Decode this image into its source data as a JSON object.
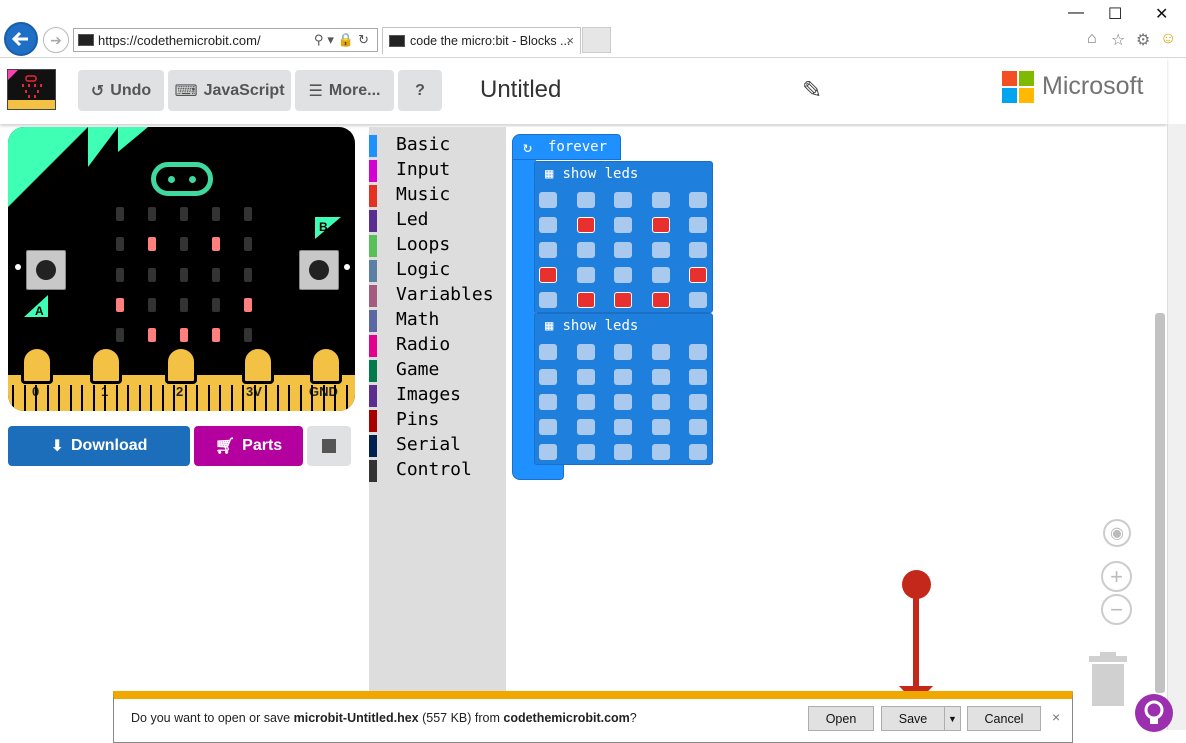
{
  "browser": {
    "url": "https://codethemicrobit.com/",
    "tab_title": "code the micro:bit - Blocks ...",
    "tab_close": "×",
    "window_controls": [
      "—",
      "☐",
      "✕"
    ]
  },
  "toolbar": {
    "undo_label": "Undo",
    "javascript_label": "JavaScript",
    "more_label": "More...",
    "help_label": "?",
    "project_title": "Untitled",
    "brand": "Microsoft"
  },
  "simulator": {
    "pins": [
      "0",
      "1",
      "2",
      "3V",
      "GND"
    ],
    "button_a": "A",
    "button_b": "B",
    "leds": [
      [
        0,
        0,
        0,
        0,
        0
      ],
      [
        0,
        1,
        0,
        1,
        0
      ],
      [
        0,
        0,
        0,
        0,
        0
      ],
      [
        1,
        0,
        0,
        0,
        1
      ],
      [
        0,
        1,
        1,
        1,
        0
      ]
    ],
    "download_label": "Download",
    "parts_label": "Parts"
  },
  "toolbox": {
    "categories": [
      {
        "label": "Basic",
        "color": "#1e90ff"
      },
      {
        "label": "Input",
        "color": "#d400d4"
      },
      {
        "label": "Music",
        "color": "#e63022"
      },
      {
        "label": "Led",
        "color": "#5c2d91"
      },
      {
        "label": "Loops",
        "color": "#59c059"
      },
      {
        "label": "Logic",
        "color": "#5b80a5"
      },
      {
        "label": "Variables",
        "color": "#a55b80"
      },
      {
        "label": "Math",
        "color": "#5b67a5"
      },
      {
        "label": "Radio",
        "color": "#e3008c"
      },
      {
        "label": "Game",
        "color": "#007a4b"
      },
      {
        "label": "Images",
        "color": "#5c2d91"
      },
      {
        "label": "Pins",
        "color": "#a80000"
      },
      {
        "label": "Serial",
        "color": "#002050"
      },
      {
        "label": "Control",
        "color": "#333333"
      }
    ]
  },
  "workspace": {
    "forever_label": "forever",
    "show_leds_label": "show leds",
    "blocks": [
      {
        "leds": [
          [
            0,
            0,
            0,
            0,
            0
          ],
          [
            0,
            1,
            0,
            1,
            0
          ],
          [
            0,
            0,
            0,
            0,
            0
          ],
          [
            1,
            0,
            0,
            0,
            1
          ],
          [
            0,
            1,
            1,
            1,
            0
          ]
        ]
      },
      {
        "leds": [
          [
            0,
            0,
            0,
            0,
            0
          ],
          [
            0,
            0,
            0,
            0,
            0
          ],
          [
            0,
            0,
            0,
            0,
            0
          ],
          [
            0,
            0,
            0,
            0,
            0
          ],
          [
            0,
            0,
            0,
            0,
            0
          ]
        ]
      }
    ]
  },
  "notification": {
    "prefix": "Do you want to open or save ",
    "filename": "microbit-Untitled.hex",
    "size": " (557 KB) from ",
    "source": "codethemicrobit.com",
    "suffix": "?",
    "open_label": "Open",
    "save_label": "Save",
    "cancel_label": "Cancel",
    "close": "×"
  },
  "colors": {
    "download": "#1c6dba",
    "parts": "#b4009e",
    "block_blue": "#1e90ff",
    "annotation": "#c4281b"
  }
}
